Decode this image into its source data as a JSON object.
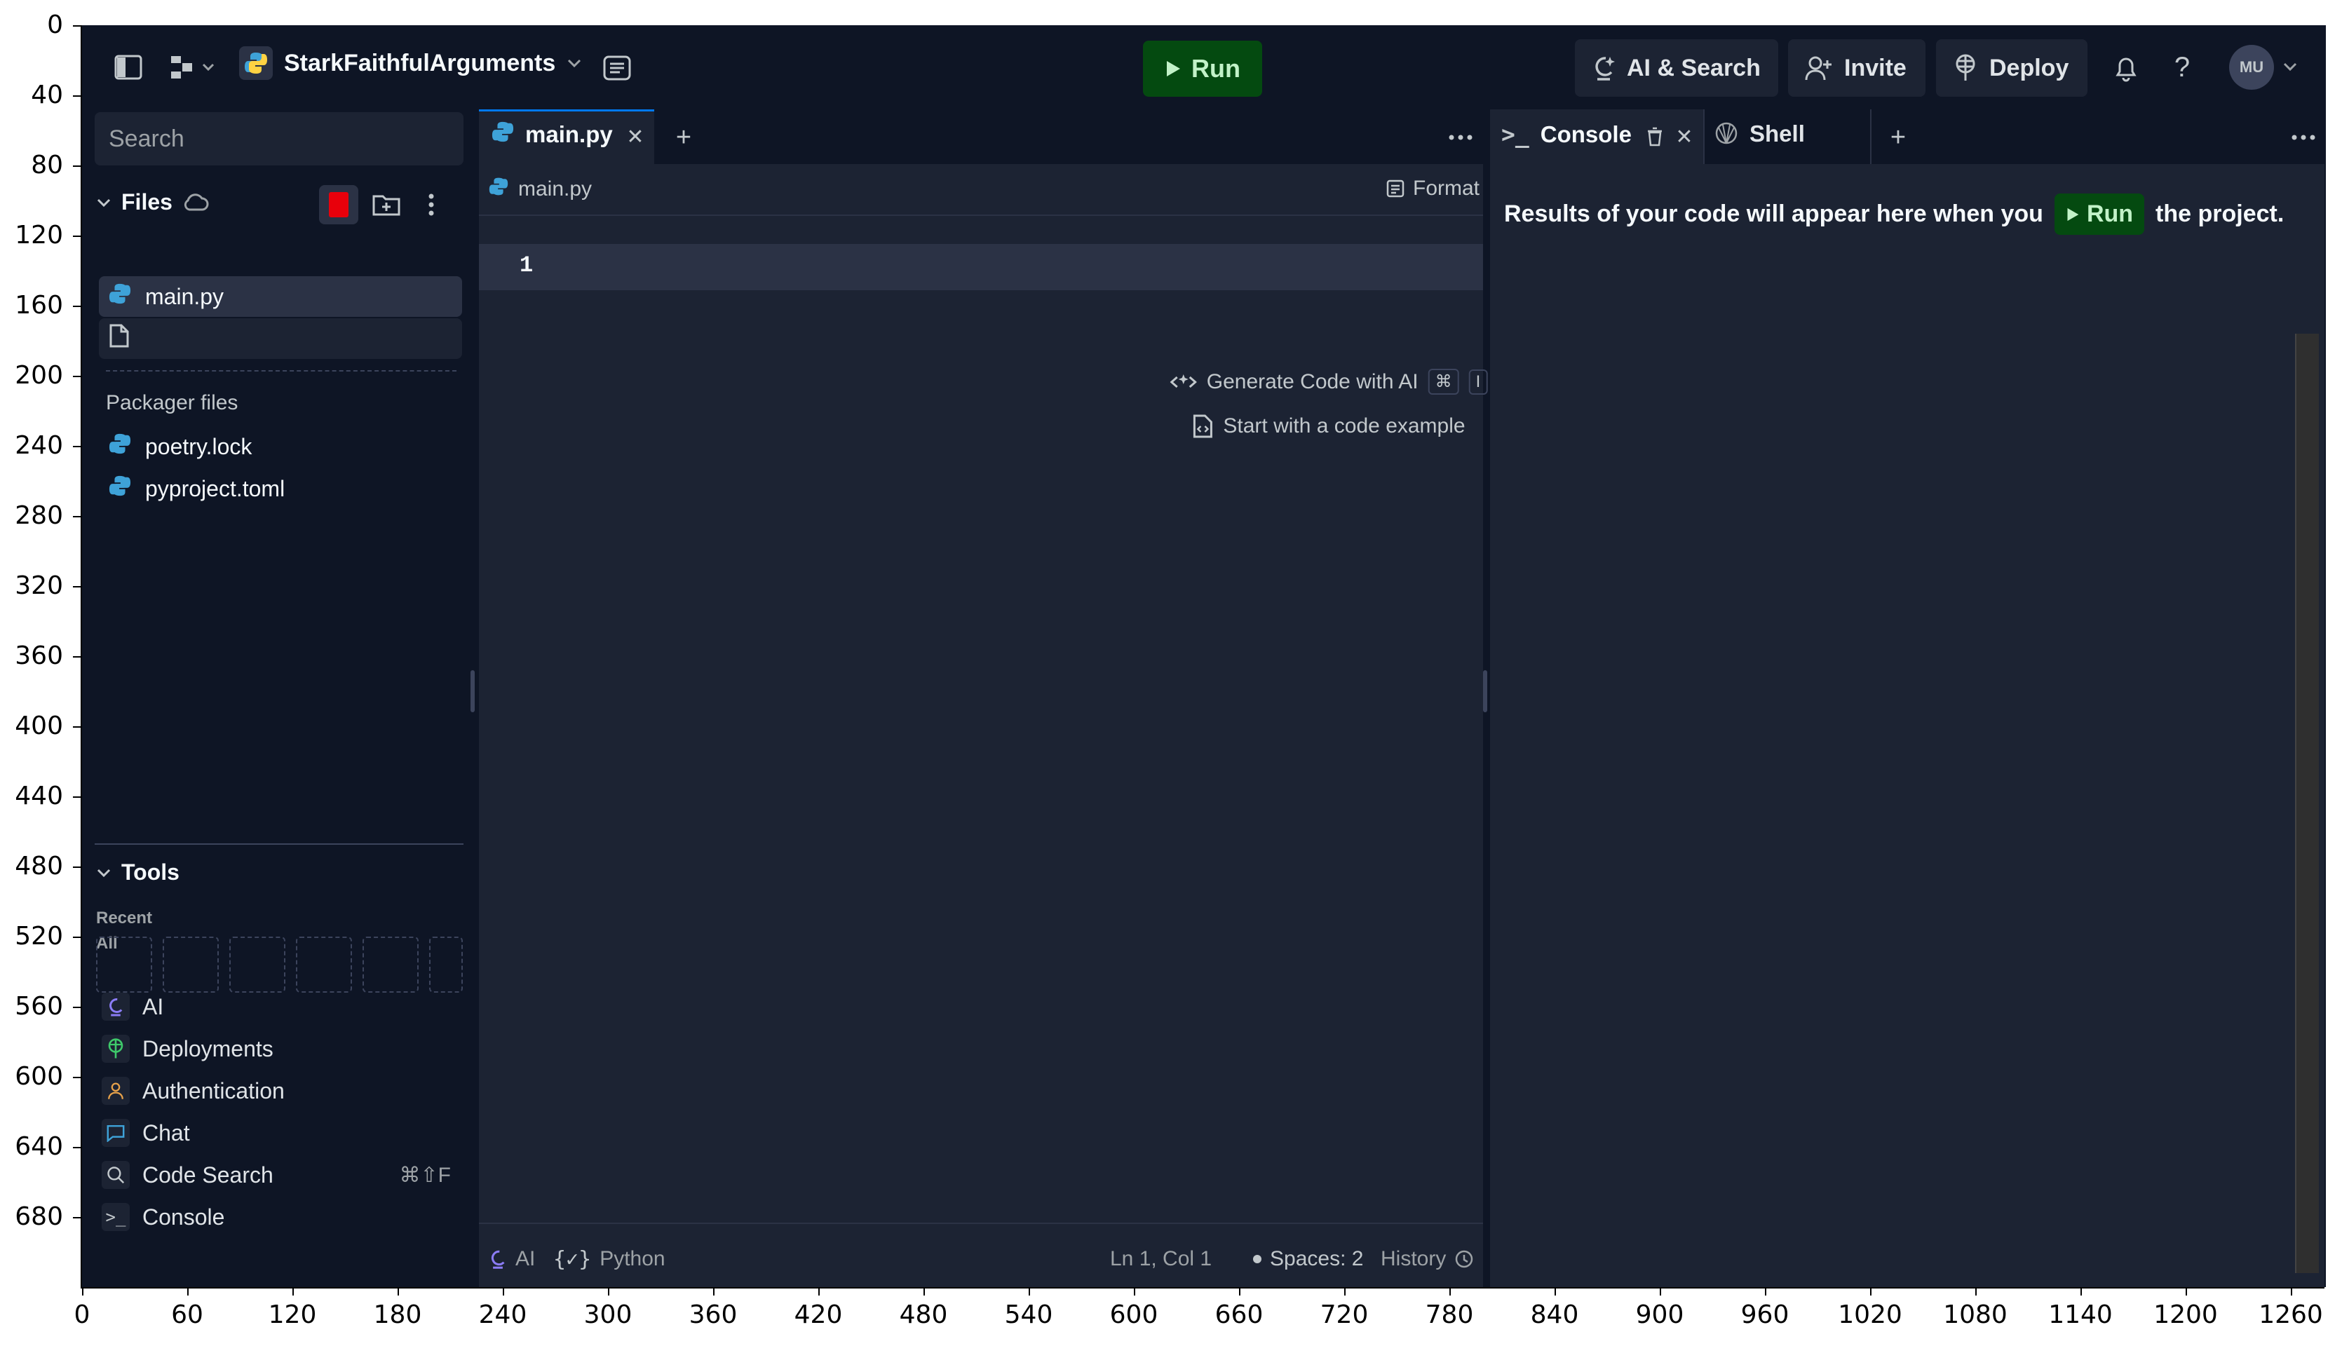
{
  "y_axis_ticks": [
    "0",
    "40",
    "80",
    "120",
    "160",
    "200",
    "240",
    "280",
    "320",
    "360",
    "400",
    "440",
    "480",
    "520",
    "560",
    "600",
    "640",
    "680"
  ],
  "x_axis_ticks": [
    "0",
    "60",
    "120",
    "180",
    "240",
    "300",
    "360",
    "420",
    "480",
    "540",
    "600",
    "660",
    "720",
    "780",
    "840",
    "900",
    "960",
    "1020",
    "1080",
    "1140",
    "1200",
    "1260"
  ],
  "topbar": {
    "repl_name": "StarkFaithfulArguments",
    "run_label": "Run",
    "ai_search_label": "AI & Search",
    "invite_label": "Invite",
    "deploy_label": "Deploy",
    "help_label": "?",
    "avatar_initials": "MU"
  },
  "sidebar": {
    "search_placeholder": "Search",
    "files_title": "Files",
    "files": [
      {
        "name": "main.py",
        "icon": "python-icon",
        "selected": true
      },
      {
        "name": "",
        "icon": "file-icon",
        "selected": false
      }
    ],
    "packager_title": "Packager files",
    "packager_files": [
      {
        "name": "poetry.lock",
        "icon": "python-icon"
      },
      {
        "name": "pyproject.toml",
        "icon": "python-icon"
      }
    ],
    "tools_title": "Tools",
    "recent_label": "Recent",
    "all_label": "All",
    "tools": [
      {
        "label": "AI",
        "icon": "ai-icon",
        "shortcut": ""
      },
      {
        "label": "Deployments",
        "icon": "deploy-icon",
        "shortcut": ""
      },
      {
        "label": "Authentication",
        "icon": "user-icon",
        "shortcut": ""
      },
      {
        "label": "Chat",
        "icon": "chat-icon",
        "shortcut": ""
      },
      {
        "label": "Code Search",
        "icon": "search-icon",
        "shortcut": "⌘⇧F"
      },
      {
        "label": "Console",
        "icon": "terminal-icon",
        "shortcut": ""
      }
    ]
  },
  "editor": {
    "tab_label": "main.py",
    "breadcrumb": "main.py",
    "format_label": "Format",
    "line_number": "1",
    "generate_hint": "Generate Code with AI",
    "generate_kbd_1": "⌘",
    "generate_kbd_2": "I",
    "example_hint": "Start with a code example",
    "status": {
      "ai_label": "AI",
      "language_label": "Python",
      "cursor_label": "Ln 1, Col 1",
      "spaces_label": "Spaces: 2",
      "history_label": "History"
    }
  },
  "console": {
    "console_tab": "Console",
    "shell_tab": "Shell",
    "message_before": "Results of your code will appear here when you",
    "run_label": "Run",
    "message_after": "the project."
  },
  "colors": {
    "background": "#0e1525",
    "panel": "#1c2333",
    "run_green": "#044a10",
    "accent_blue": "#0079f2",
    "python_icon": "#3ea2d8"
  }
}
